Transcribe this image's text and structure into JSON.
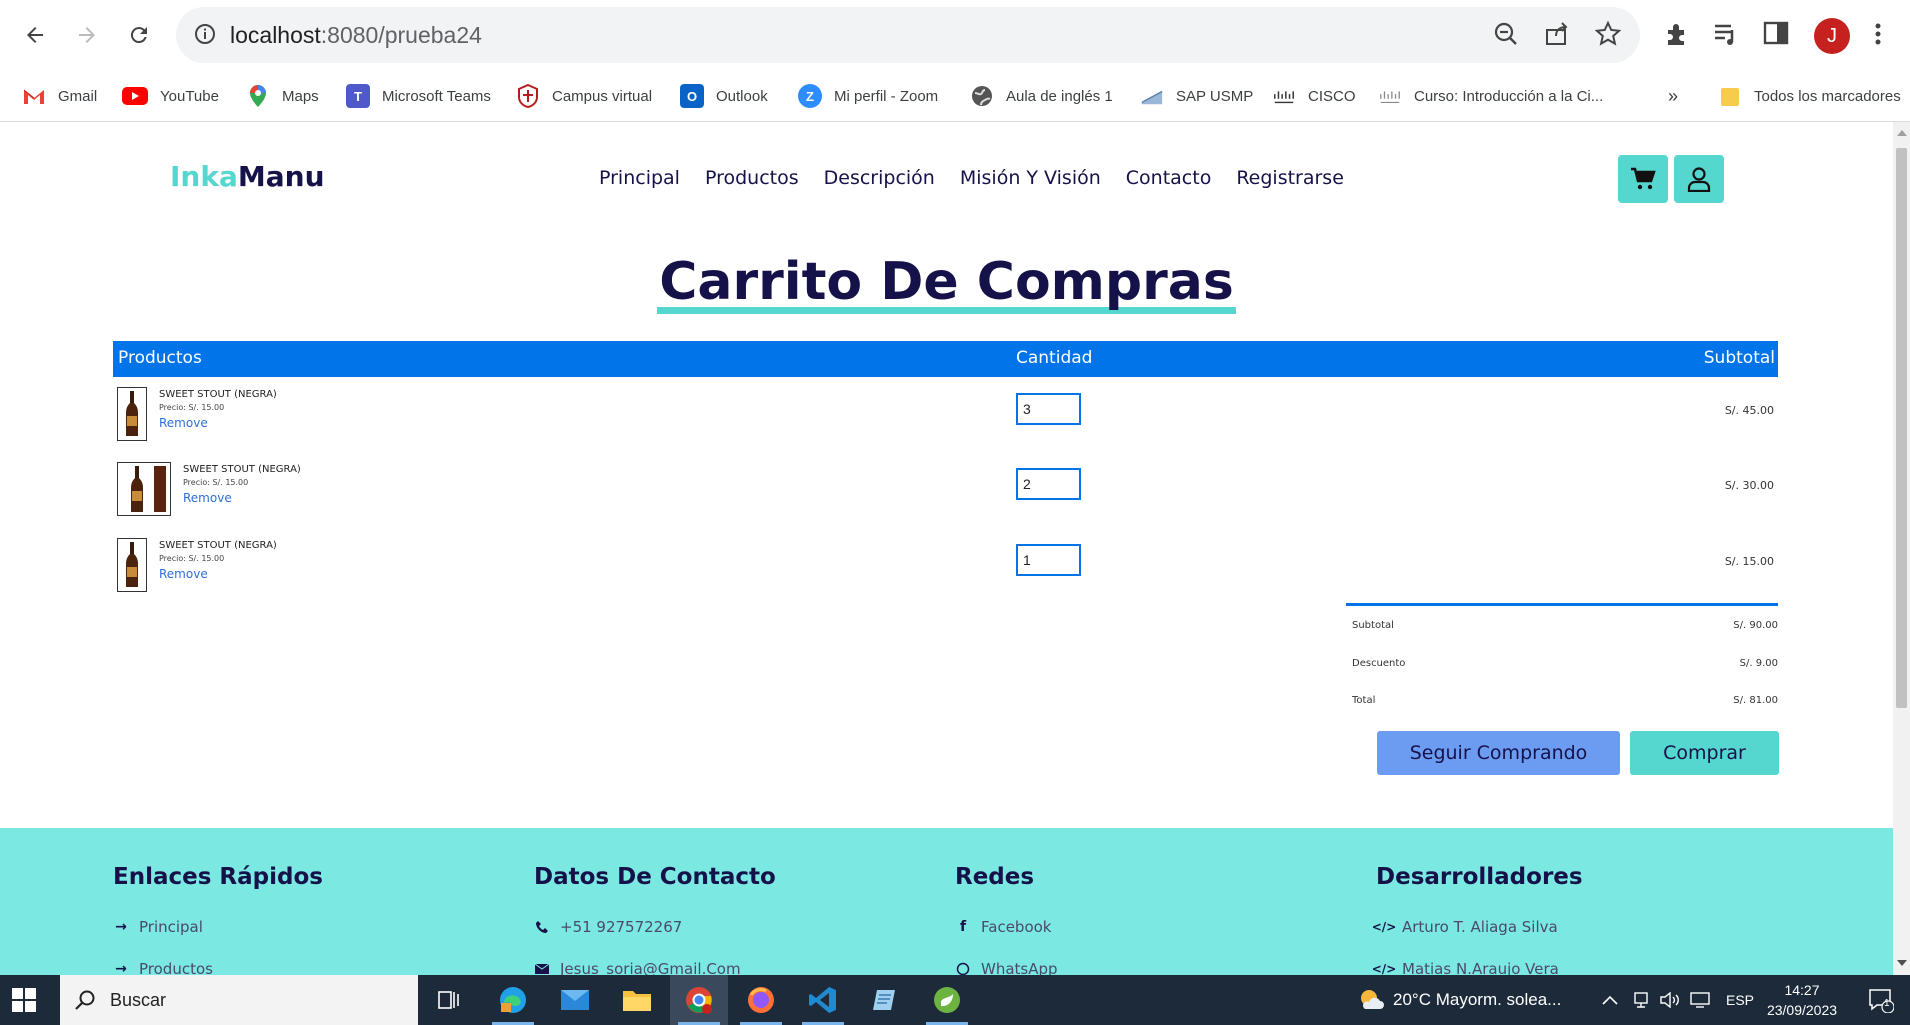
{
  "browser": {
    "url_host": "localhost",
    "url_path": ":8080/prueba24",
    "profile_initial": "J",
    "bookmarks": [
      {
        "label": "Gmail",
        "icon": "gmail-icon"
      },
      {
        "label": "YouTube",
        "icon": "youtube-icon"
      },
      {
        "label": "Maps",
        "icon": "maps-icon"
      },
      {
        "label": "Microsoft Teams",
        "icon": "teams-icon"
      },
      {
        "label": "Campus virtual",
        "icon": "campus-icon"
      },
      {
        "label": "Outlook",
        "icon": "outlook-icon"
      },
      {
        "label": "Mi perfil - Zoom",
        "icon": "zoom-icon"
      },
      {
        "label": "Aula de inglés 1",
        "icon": "globe-icon"
      },
      {
        "label": "SAP USMP",
        "icon": "sap-icon"
      },
      {
        "label": "CISCO",
        "icon": "cisco-icon"
      },
      {
        "label": "Curso: Introducción a la Ci...",
        "icon": "cisco-icon"
      }
    ],
    "overflow_label": "»",
    "all_bookmarks_label": "Todos los marcadores"
  },
  "site": {
    "logo_part1": "Inka",
    "logo_part2": "Manu",
    "nav": [
      "Principal",
      "Productos",
      "Descripción",
      "Misión Y Visión",
      "Contacto",
      "Registrarse"
    ],
    "accent": "#55d6ce",
    "primary": "#0074e8",
    "navy": "#15124a"
  },
  "cart": {
    "title": "Carrito De Compras",
    "headers": {
      "products": "Productos",
      "quantity": "Cantidad",
      "subtotal": "Subtotal"
    },
    "items": [
      {
        "name": "SWEET STOUT (NEGRA)",
        "price": "Precio: S/. 15.00",
        "remove": "Remove",
        "quantity": "3",
        "subtotal": "S/. 45.00"
      },
      {
        "name": "SWEET STOUT (NEGRA)",
        "price": "Precio: S/. 15.00",
        "remove": "Remove",
        "quantity": "2",
        "subtotal": "S/. 30.00"
      },
      {
        "name": "SWEET STOUT (NEGRA)",
        "price": "Precio: S/. 15.00",
        "remove": "Remove",
        "quantity": "1",
        "subtotal": "S/. 15.00"
      }
    ],
    "totals": {
      "subtotal_label": "Subtotal",
      "subtotal_value": "S/. 90.00",
      "discount_label": "Descuento",
      "discount_value": "S/. 9.00",
      "total_label": "Total",
      "total_value": "S/. 81.00"
    },
    "continue_button": "Seguir Comprando",
    "buy_button": "Comprar"
  },
  "footer": {
    "quick_links": {
      "title": "Enlaces Rápidos",
      "items": [
        "Principal",
        "Productos"
      ]
    },
    "contact": {
      "title": "Datos De Contacto",
      "items": [
        "+51 927572267",
        "Jesus_soria@Gmail.Com"
      ]
    },
    "social": {
      "title": "Redes",
      "items": [
        "Facebook",
        "WhatsApp"
      ]
    },
    "developers": {
      "title": "Desarrolladores",
      "items": [
        "Arturo T. Aliaga Silva",
        "Matias N.Araujo Vera"
      ]
    }
  },
  "taskbar": {
    "search_placeholder": "Buscar",
    "weather": "20°C  Mayorm. solea...",
    "language": "ESP",
    "time": "14:27",
    "date": "23/09/2023",
    "notifications": "1"
  }
}
